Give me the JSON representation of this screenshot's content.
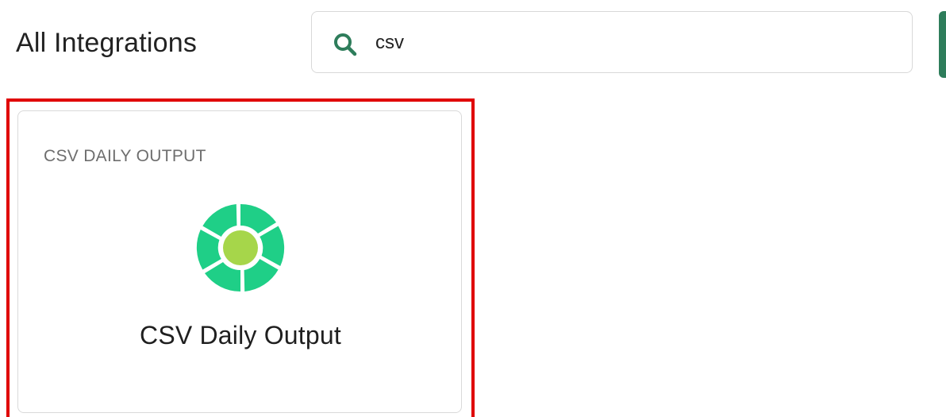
{
  "header": {
    "title": "All Integrations"
  },
  "search": {
    "value": "csv",
    "icon": "search-icon"
  },
  "results": [
    {
      "category": "CSV DAILY OUTPUT",
      "name": "CSV Daily Output",
      "logo": "pinwheel-logo-icon"
    }
  ],
  "colors": {
    "accent": "#2e7d5b",
    "highlight": "#e00000",
    "logo_green": "#1fcf87",
    "logo_center": "#a6d64a"
  }
}
